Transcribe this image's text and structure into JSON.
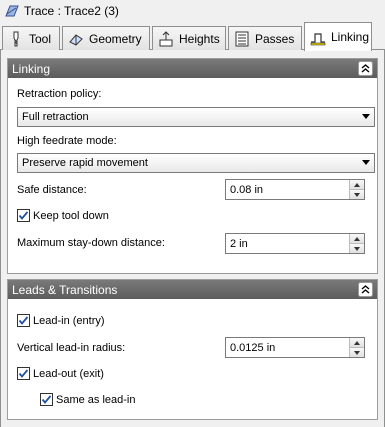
{
  "window": {
    "title": "Trace : Trace2 (3)",
    "icon": "trace-icon"
  },
  "tabs": [
    {
      "label": "Tool",
      "icon": "tool-icon",
      "active": false
    },
    {
      "label": "Geometry",
      "icon": "geometry-icon",
      "active": false
    },
    {
      "label": "Heights",
      "icon": "heights-icon",
      "active": false
    },
    {
      "label": "Passes",
      "icon": "passes-icon",
      "active": false
    },
    {
      "label": "Linking",
      "icon": "linking-icon",
      "active": true
    }
  ],
  "linking": {
    "header": "Linking",
    "retraction_policy_label": "Retraction policy:",
    "retraction_policy_value": "Full retraction",
    "high_feedrate_label": "High feedrate mode:",
    "high_feedrate_value": "Preserve rapid movement",
    "safe_distance_label": "Safe distance:",
    "safe_distance_value": "0.08 in",
    "keep_tool_down_label": "Keep tool down",
    "keep_tool_down_checked": true,
    "max_stay_down_label": "Maximum stay-down distance:",
    "max_stay_down_value": "2 in"
  },
  "leads": {
    "header": "Leads & Transitions",
    "lead_in_label": "Lead-in (entry)",
    "lead_in_checked": true,
    "vertical_radius_label": "Vertical lead-in radius:",
    "vertical_radius_value": "0.0125 in",
    "lead_out_label": "Lead-out (exit)",
    "lead_out_checked": true,
    "same_as_lead_in_label": "Same as lead-in",
    "same_as_lead_in_checked": true
  },
  "colors": {
    "group_header_bg": "#6a6a6a",
    "panel_bg": "#f0f0f0",
    "check_mark": "#2050a0"
  }
}
